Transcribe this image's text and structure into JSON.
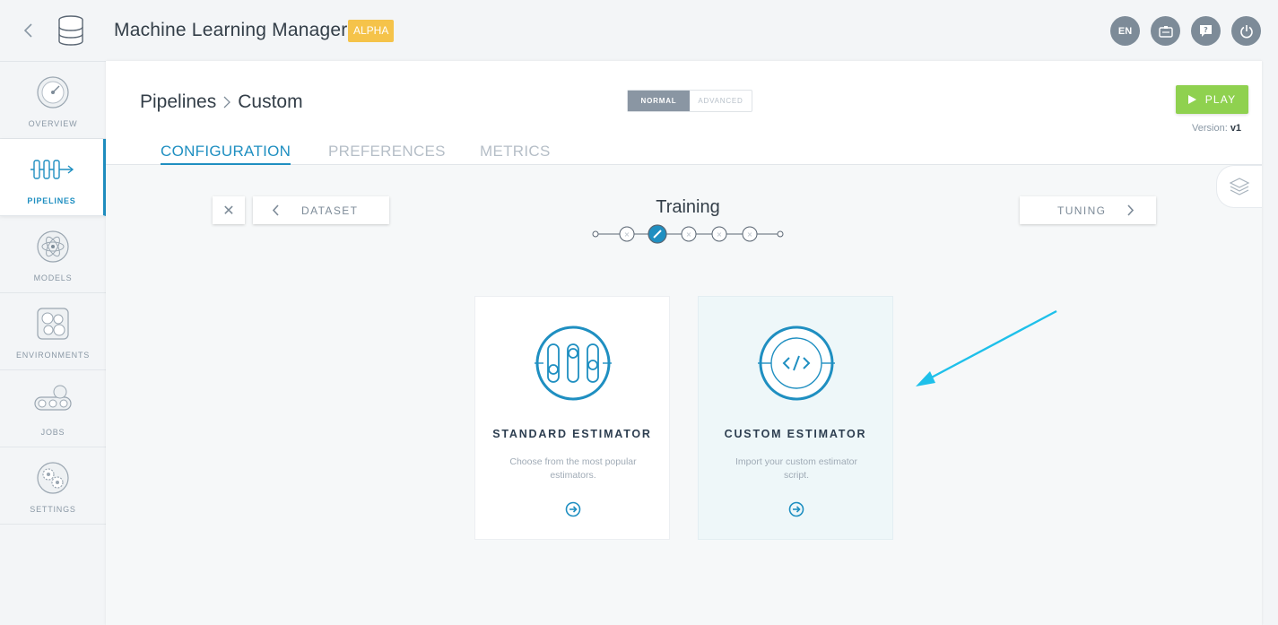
{
  "app": {
    "title": "Machine Learning Manager",
    "badge": "ALPHA",
    "language": "EN"
  },
  "sidebar": {
    "items": [
      {
        "label": "OVERVIEW",
        "icon": "gauge-icon",
        "active": false
      },
      {
        "label": "PIPELINES",
        "icon": "pipeline-icon",
        "active": true
      },
      {
        "label": "MODELS",
        "icon": "atom-icon",
        "active": false
      },
      {
        "label": "ENVIRONMENTS",
        "icon": "cells-icon",
        "active": false
      },
      {
        "label": "JOBS",
        "icon": "conveyor-icon",
        "active": false
      },
      {
        "label": "SETTINGS",
        "icon": "gears-icon",
        "active": false
      }
    ]
  },
  "header": {
    "breadcrumb": [
      "Pipelines",
      "Custom"
    ],
    "mode": {
      "normal": "NORMAL",
      "advanced": "ADVANCED",
      "selected": "NORMAL"
    },
    "play_label": "PLAY",
    "version_label": "Version:",
    "version_value": "v1",
    "tabs": [
      {
        "label": "CONFIGURATION",
        "active": true
      },
      {
        "label": "PREFERENCES",
        "active": false
      },
      {
        "label": "METRICS",
        "active": false
      }
    ]
  },
  "stepnav": {
    "prev_label": "DATASET",
    "next_label": "TUNING",
    "title": "Training",
    "current_step": 3,
    "total_steps": 7
  },
  "cards": [
    {
      "title": "STANDARD ESTIMATOR",
      "description": "Choose from the most popular estimators.",
      "icon": "sliders-icon",
      "selected": false
    },
    {
      "title": "CUSTOM ESTIMATOR",
      "description": "Import your custom estimator script.",
      "icon": "code-icon",
      "selected": true
    }
  ],
  "colors": {
    "accent": "#1f8fc1",
    "play": "#8fd14f",
    "badge": "#f5c34a",
    "annotation": "#1ec0ea"
  }
}
